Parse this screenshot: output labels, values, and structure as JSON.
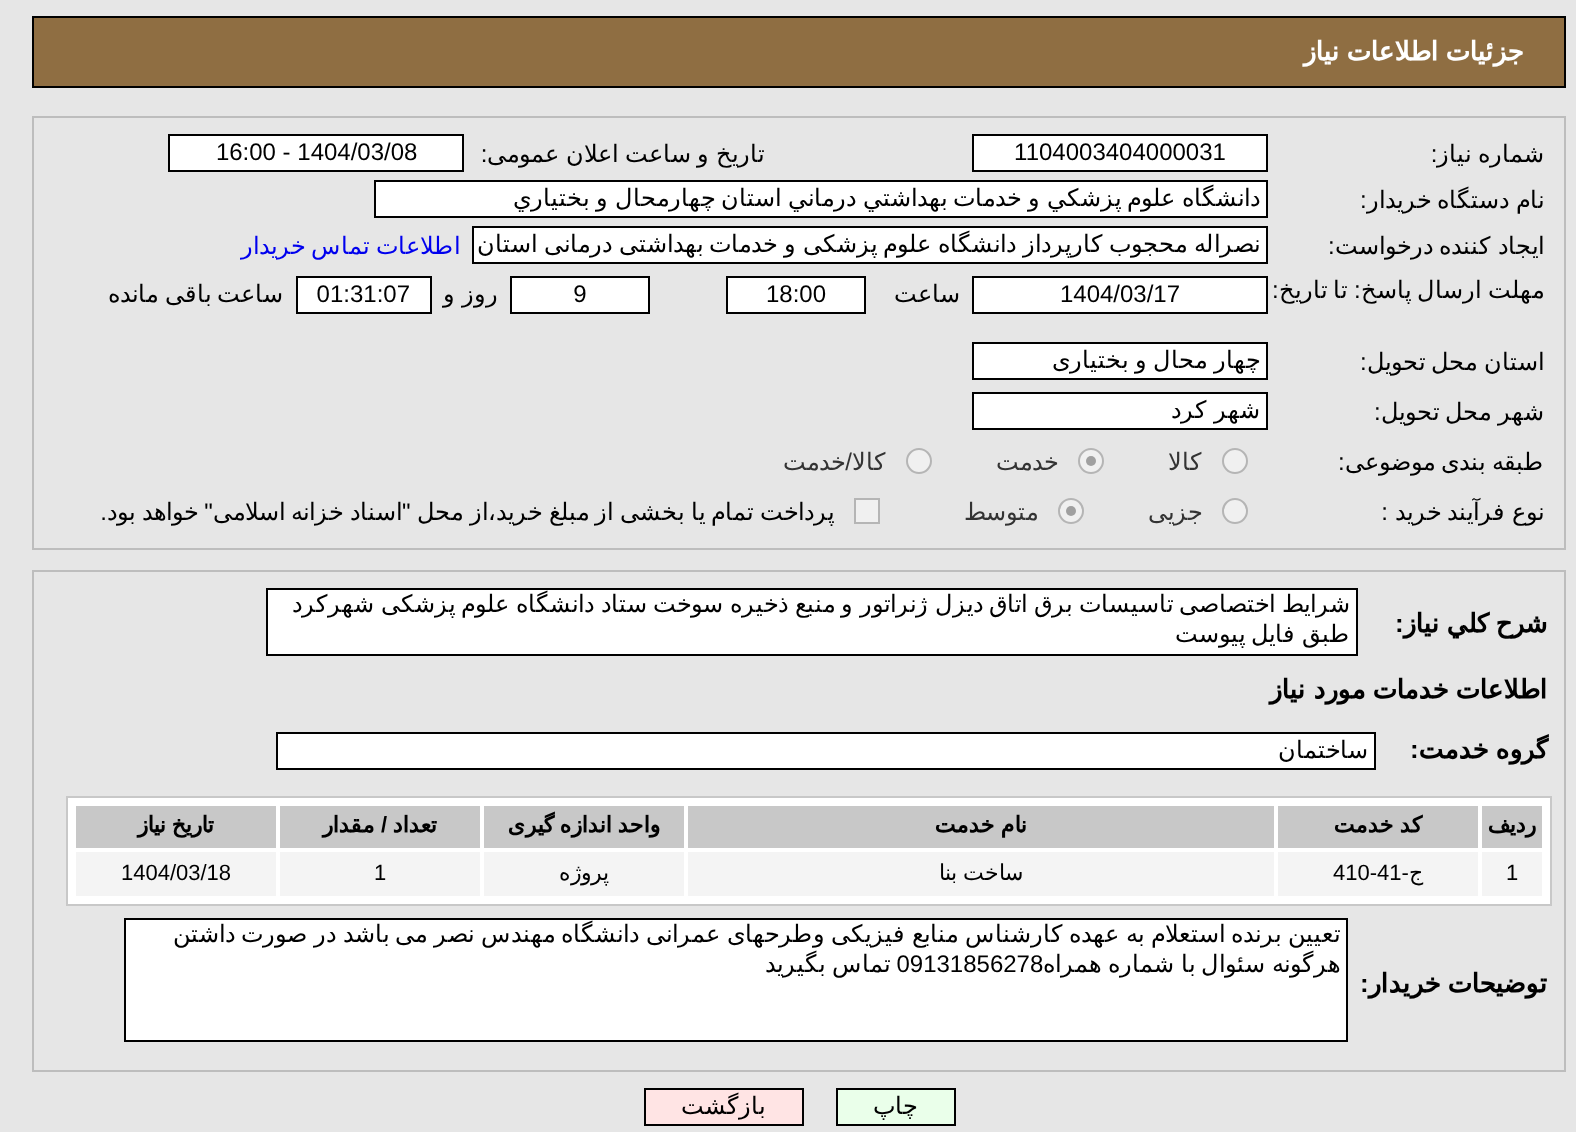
{
  "header": {
    "title": "جزئیات اطلاعات نیاز"
  },
  "need_number": {
    "label": "شماره نیاز:",
    "value": "1104003404000031"
  },
  "announce": {
    "label": "تاریخ و ساعت اعلان عمومی:",
    "value": "1404/03/08 - 16:00"
  },
  "buyer": {
    "label": "نام دستگاه خریدار:",
    "value": "دانشگاه علوم پزشکي و خدمات بهداشتي درماني استان چهارمحال و بختياري"
  },
  "creator": {
    "label": "ایجاد کننده درخواست:",
    "value": "نصراله محجوب کارپرداز دانشگاه علوم پزشکی و خدمات بهداشتی درمانی استان",
    "link": "اطلاعات تماس خریدار"
  },
  "deadline": {
    "label": "مهلت ارسال پاسخ: تا تاریخ:",
    "date": "1404/03/17",
    "time_label": "ساعت",
    "time": "18:00",
    "days": "9",
    "days_label": "روز و",
    "remaining": "01:31:07",
    "remaining_label": "ساعت باقی مانده"
  },
  "province": {
    "label": "استان محل تحویل:",
    "value": "چهار محال و بختیاری"
  },
  "city": {
    "label": "شهر محل تحویل:",
    "value": "شهر کرد"
  },
  "category": {
    "label": "طبقه بندی موضوعی:",
    "options": [
      {
        "label": "کالا",
        "selected": false
      },
      {
        "label": "خدمت",
        "selected": true
      },
      {
        "label": "کالا/خدمت",
        "selected": false
      }
    ]
  },
  "process": {
    "label": "نوع فرآیند خرید :",
    "options": [
      {
        "label": "جزیی",
        "selected": false
      },
      {
        "label": "متوسط",
        "selected": true
      }
    ],
    "payment": {
      "label": "پرداخت تمام یا بخشی از مبلغ خرید،از محل \"اسناد خزانه اسلامی\" خواهد بود.",
      "checked": false
    }
  },
  "description": {
    "label": "شرح کلي نياز:",
    "value": "شرایط اختصاصی تاسیسات برق اتاق دیزل ژنراتور و منبع ذخیره سوخت ستاد دانشگاه علوم پزشکی شهرکرد طبق فایل پیوست"
  },
  "services_heading": "اطلاعات خدمات مورد نياز",
  "service_group": {
    "label": "گروه خدمت:",
    "value": "ساختمان"
  },
  "table": {
    "columns": [
      "ردیف",
      "کد خدمت",
      "نام خدمت",
      "واحد اندازه گیری",
      "تعداد / مقدار",
      "تاریخ نیاز"
    ],
    "rows": [
      [
        "1",
        "ج-41-410",
        "ساخت بنا",
        "پروژه",
        "1",
        "1404/03/18"
      ]
    ]
  },
  "notes": {
    "label": "توضیحات خریدار:",
    "value": "تعیین برنده استعلام به عهده کارشناس منابع فیزیکی وطرحهای عمرانی دانشگاه مهندس نصر می باشد در صورت داشتن هرگونه سئوال با شماره همراه09131856278 تماس بگیرید"
  },
  "buttons": [
    {
      "label": "چاپ",
      "kind": "print"
    },
    {
      "label": "بازگشت",
      "kind": "back"
    }
  ]
}
